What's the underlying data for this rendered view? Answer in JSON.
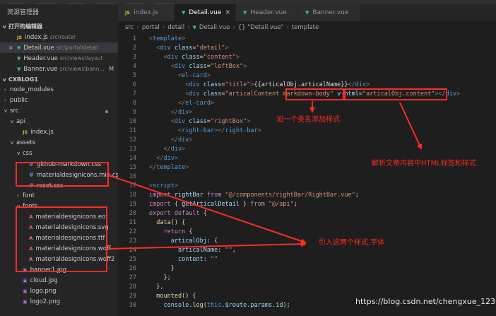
{
  "sidebar": {
    "title": "资源管理器",
    "open_editors_header": "打开的编辑器",
    "open_editors": [
      {
        "icon": "js",
        "name": "index.js",
        "path": "src\\router",
        "active": false,
        "close": false
      },
      {
        "icon": "vue",
        "name": "Detail.vue",
        "path": "src\\portal\\detail",
        "active": true,
        "close": true
      },
      {
        "icon": "vue",
        "name": "Header.vue",
        "path": "src\\views\\layout",
        "active": false,
        "close": false
      },
      {
        "icon": "vue",
        "name": "Banner.vue",
        "path": "src\\views\\bann...",
        "active": false,
        "close": false,
        "badge": "M"
      }
    ],
    "project_header": "CXBLOG1",
    "tree": [
      {
        "depth": 0,
        "chevron": ">",
        "icon": "",
        "name": "node_modules"
      },
      {
        "depth": 0,
        "chevron": ">",
        "icon": "",
        "name": "public"
      },
      {
        "depth": 0,
        "chevron": "v",
        "icon": "",
        "name": "src",
        "dot": true
      },
      {
        "depth": 1,
        "chevron": "v",
        "icon": "",
        "name": "api"
      },
      {
        "depth": 2,
        "chevron": "",
        "icon": "js",
        "name": "index.js"
      },
      {
        "depth": 1,
        "chevron": "v",
        "icon": "",
        "name": "assets"
      },
      {
        "depth": 2,
        "chevron": "v",
        "icon": "",
        "name": "css"
      },
      {
        "depth": 3,
        "chevron": "",
        "icon": "css",
        "name": "github-markdown.css"
      },
      {
        "depth": 3,
        "chevron": "",
        "icon": "css",
        "name": "materialdesignicons.min.css"
      },
      {
        "depth": 3,
        "chevron": "",
        "icon": "css",
        "name": "reset.css"
      },
      {
        "depth": 2,
        "chevron": ">",
        "icon": "",
        "name": "font"
      },
      {
        "depth": 2,
        "chevron": "v",
        "icon": "",
        "name": "fonts"
      },
      {
        "depth": 3,
        "chevron": "",
        "icon": "font",
        "name": "materialdesignicons.eot"
      },
      {
        "depth": 3,
        "chevron": "",
        "icon": "font",
        "name": "materialdesignicons.svg"
      },
      {
        "depth": 3,
        "chevron": "",
        "icon": "font",
        "name": "materialdesignicons.ttf"
      },
      {
        "depth": 3,
        "chevron": "",
        "icon": "font",
        "name": "materialdesignicons.woff"
      },
      {
        "depth": 3,
        "chevron": "",
        "icon": "font",
        "name": "materialdesignicons.woff2"
      },
      {
        "depth": 2,
        "chevron": "",
        "icon": "img",
        "name": "banner1.jpg"
      },
      {
        "depth": 2,
        "chevron": "",
        "icon": "img",
        "name": "cloud.jpg"
      },
      {
        "depth": 2,
        "chevron": "",
        "icon": "img",
        "name": "logo.png"
      },
      {
        "depth": 2,
        "chevron": "",
        "icon": "img",
        "name": "logo2.png"
      }
    ]
  },
  "tabs": [
    {
      "icon": "js",
      "label": "index.js",
      "active": false
    },
    {
      "icon": "vue",
      "label": "Detail.vue",
      "active": true
    },
    {
      "icon": "vue",
      "label": "Header.vue",
      "active": false
    },
    {
      "icon": "vue",
      "label": "Banner.vue",
      "active": false
    }
  ],
  "breadcrumb": [
    "src",
    "portal",
    "detail",
    "Detail.vue",
    "{} \"Detail.vue\"",
    "template"
  ],
  "code_lines": [
    {
      "n": "1",
      "html": "<span class=\"p\">&lt;</span><span class=\"t\">template</span><span class=\"p\">&gt;</span>"
    },
    {
      "n": "2",
      "html": "  <span class=\"p\">&lt;</span><span class=\"t\">div</span> <span class=\"a\">class</span>=<span class=\"s\">\"detail\"</span><span class=\"p\">&gt;</span>"
    },
    {
      "n": "3",
      "html": "    <span class=\"p\">&lt;</span><span class=\"t\">div</span> <span class=\"a\">class</span>=<span class=\"s\">\"content\"</span><span class=\"p\">&gt;</span>"
    },
    {
      "n": "4",
      "html": "      <span class=\"p\">&lt;</span><span class=\"t\">div</span> <span class=\"a\">class</span>=<span class=\"s\">\"leftBox\"</span><span class=\"p\">&gt;</span>"
    },
    {
      "n": "5",
      "html": "        <span class=\"p\">&lt;</span><span class=\"t\">el-card</span><span class=\"p\">&gt;</span>"
    },
    {
      "n": "6",
      "html": "          <span class=\"p\">&lt;</span><span class=\"t\">div</span> <span class=\"a\">class</span>=<span class=\"s\">\"title\"</span><span class=\"p\">&gt;</span>{{articalObj.articalName}}<span class=\"p\">&lt;/</span><span class=\"t\">div</span><span class=\"p\">&gt;</span>"
    },
    {
      "n": "7",
      "html": "          <span class=\"p\">&lt;</span><span class=\"t\">div</span> <span class=\"a\">class</span>=<span class=\"s\">\"articalContent markdown-body\"</span> <span class=\"a\">v-html</span>=<span class=\"s\">\"articalObj.content\"</span><span class=\"p\">&gt;&lt;/</span><span class=\"t\">div</span><span class=\"p\">&gt;</span>"
    },
    {
      "n": "8",
      "html": "        <span class=\"p\">&lt;/</span><span class=\"t\">el-card</span><span class=\"p\">&gt;</span>"
    },
    {
      "n": "9",
      "html": "      <span class=\"p\">&lt;/</span><span class=\"t\">div</span><span class=\"p\">&gt;</span>"
    },
    {
      "n": "10",
      "html": "      <span class=\"p\">&lt;</span><span class=\"t\">div</span> <span class=\"a\">class</span>=<span class=\"s\">\"rightBox\"</span><span class=\"p\">&gt;</span>"
    },
    {
      "n": "11",
      "html": "        <span class=\"p\">&lt;</span><span class=\"t\">right-bar</span><span class=\"p\">&gt;&lt;/</span><span class=\"t\">right-bar</span><span class=\"p\">&gt;</span>"
    },
    {
      "n": "12",
      "html": "      <span class=\"p\">&lt;/</span><span class=\"t\">div</span><span class=\"p\">&gt;</span>"
    },
    {
      "n": "13",
      "html": "    <span class=\"p\">&lt;/</span><span class=\"t\">div</span><span class=\"p\">&gt;</span>"
    },
    {
      "n": "14",
      "html": "  <span class=\"p\">&lt;/</span><span class=\"t\">div</span><span class=\"p\">&gt;</span>"
    },
    {
      "n": "15",
      "html": "<span class=\"p\">&lt;/</span><span class=\"t\">template</span><span class=\"p\">&gt;</span>"
    },
    {
      "n": "16",
      "html": ""
    },
    {
      "n": "17",
      "html": "<span class=\"p\">&lt;</span><span class=\"t\">script</span><span class=\"p\">&gt;</span>"
    },
    {
      "n": "18",
      "html": "<span class=\"k\">import</span> <span class=\"v\">rightBar</span> <span class=\"k\">from</span> <span class=\"s\">\"@/components/rightBar/RightBar.vue\"</span>;"
    },
    {
      "n": "19",
      "html": "<span class=\"k\">import</span> { <span class=\"v\">getArticalDetail</span> } <span class=\"k\">from</span> <span class=\"s\">\"@/api\"</span>;"
    },
    {
      "n": "20",
      "html": "<span class=\"k\">export</span> <span class=\"k\">default</span> {"
    },
    {
      "n": "21",
      "html": "  <span class=\"f\">data</span>() {"
    },
    {
      "n": "22",
      "html": "    <span class=\"k\">return</span> {"
    },
    {
      "n": "23",
      "html": "      <span class=\"v\">articalObj</span>: {"
    },
    {
      "n": "24",
      "html": "        <span class=\"v\">articalName</span>: <span class=\"s\">\"\"</span>,"
    },
    {
      "n": "25",
      "html": "        <span class=\"v\">content</span>: <span class=\"s\">\"\"</span>"
    },
    {
      "n": "26",
      "html": "      }"
    },
    {
      "n": "27",
      "html": "    };"
    },
    {
      "n": "28",
      "html": "  },"
    },
    {
      "n": "29",
      "html": "  <span class=\"f\">mounted</span>() {"
    },
    {
      "n": "30",
      "html": "    <span class=\"v\">console</span>.<span class=\"f\">log</span>(<span class=\"t\">this</span>.<span class=\"v\">$route</span>.<span class=\"v\">params</span>.<span class=\"v\">id</span>);"
    }
  ],
  "annotations": {
    "add_class": "加一个类名添加样式",
    "parse_html": "解析文章内容中HTML标签和样式",
    "import_fonts": "引入这两个样式,字体"
  },
  "watermark": "https://blog.csdn.net/chengxue_123",
  "colors": {
    "annotation_red": "#ff2a2a",
    "editor_bg": "#1e1e1e",
    "sidebar_bg": "#252526"
  }
}
